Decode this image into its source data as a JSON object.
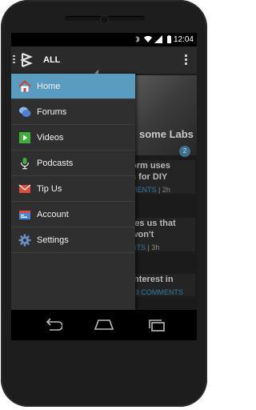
{
  "status_bar": {
    "time": "12:04"
  },
  "action_bar": {
    "title": "ALL"
  },
  "drawer": {
    "items": [
      {
        "label": "Home",
        "icon": "home-icon",
        "active": true
      },
      {
        "label": "Forums",
        "icon": "forums-icon",
        "active": false
      },
      {
        "label": "Videos",
        "icon": "videos-icon",
        "active": false
      },
      {
        "label": "Podcasts",
        "icon": "podcasts-icon",
        "active": false
      },
      {
        "label": "Tip Us",
        "icon": "mail-icon",
        "active": false
      },
      {
        "label": "Account",
        "icon": "account-icon",
        "active": false
      },
      {
        "label": "Settings",
        "icon": "gear-icon",
        "active": false
      }
    ]
  },
  "background_feed": {
    "hero_text": "some Labs",
    "hero_badge": "2",
    "cards": [
      {
        "title_line1": "orm uses",
        "title_line2": "s for DIY",
        "meta_link": "MENTS",
        "meta_sep": " | ",
        "meta_time": "2h"
      },
      {
        "title_line1": "res us that",
        "title_line2": "won't",
        "meta_link": "NTS",
        "meta_sep": " | ",
        "meta_time": "3h"
      },
      {
        "title_line1": "interest in",
        "title_line2": "",
        "meta_link": "| 3 COMMENTS",
        "meta_sep": "",
        "meta_time": ""
      }
    ]
  },
  "colors": {
    "accent": "#5a9bc0",
    "drawer_bg": "#2f2f2f",
    "action_bar_bg": "#2a2a2a",
    "link": "#2f7ea5"
  }
}
